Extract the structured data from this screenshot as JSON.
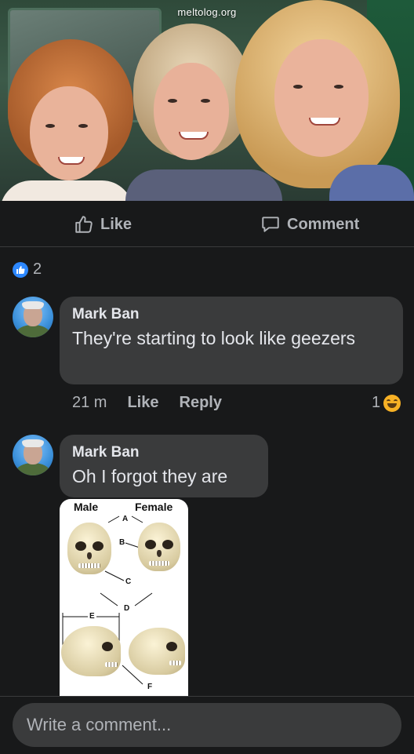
{
  "photo": {
    "watermark": "meltolog.org"
  },
  "actions": {
    "like_label": "Like",
    "comment_label": "Comment"
  },
  "post_reactions": {
    "count": "2",
    "icon": "like-icon"
  },
  "comments": [
    {
      "author": "Mark Ban",
      "text": "They're starting to look like geezers",
      "time": "21 m",
      "like_label": "Like",
      "reply_label": "Reply",
      "reaction_count": "1",
      "reaction_icon": "haha-icon"
    },
    {
      "author": "Mark Ban",
      "text": "Oh I forgot they are",
      "image": {
        "label_male": "Male",
        "label_female": "Female",
        "letters": [
          "A",
          "B",
          "C",
          "D",
          "E",
          "F"
        ]
      }
    }
  ],
  "composer": {
    "placeholder": "Write a comment..."
  },
  "colors": {
    "accent": "#2d88ff",
    "background": "#18191a",
    "bubble": "#3a3b3c",
    "haha": "#f7b125"
  }
}
